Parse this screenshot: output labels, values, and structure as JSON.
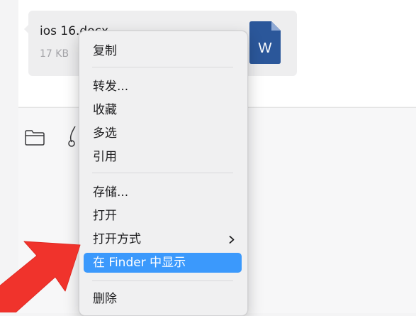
{
  "file": {
    "name": "ios 16.docx",
    "size": "17 KB",
    "icon_letter": "W",
    "icon_color": "#2b579a"
  },
  "toolbar": {
    "folder_icon": "folder-icon",
    "scissors_icon": "scissors-icon"
  },
  "context_menu": {
    "copy": "复制",
    "forward": "转发...",
    "favorite": "收藏",
    "multi_select": "多选",
    "quote": "引用",
    "save": "存储...",
    "open": "打开",
    "open_with": "打开方式",
    "show_in_finder": "在 Finder 中显示",
    "delete": "删除",
    "highlight_color": "#3b99fc"
  },
  "annotation": {
    "arrow_color": "#f0332c"
  }
}
